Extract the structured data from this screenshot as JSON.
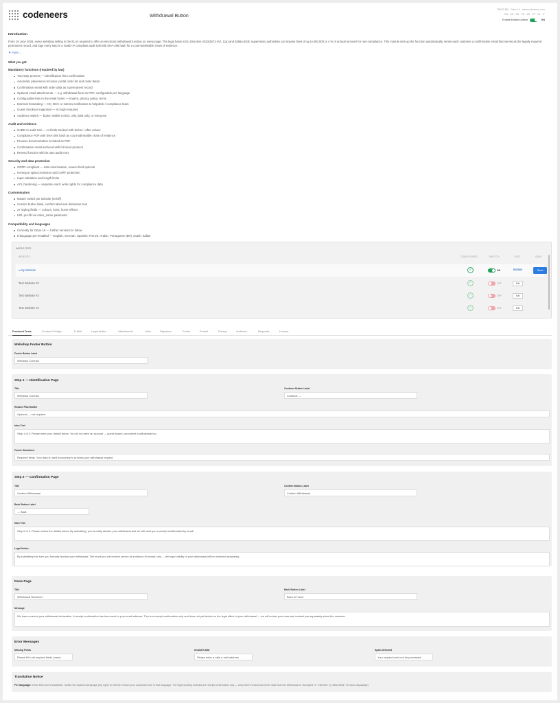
{
  "header": {
    "brand": "codeneers",
    "title": "Withdrawal Button",
    "meta_line1": "TR4E2.BB · Odoo 19 · www.codeneers.com",
    "meta_line2": "EN · DE · ES · FR · AR · PT · NL · IT",
    "global_toggle_label": "Enable/Disable Addon",
    "global_toggle_state": "ON"
  },
  "intro": {
    "heading": "Introduction",
    "paragraph": "From 19 June 2026, every webshop selling in the EU is required to offer an electronic withdrawal function on every page. The legal basis is EU Directive 2023/2673 (Art. 11a) and §356a BGB; supervisory authorities can impose fines of up to €50,000 or 4 % of annual turnover for non-compliance. This module sets up the function automatically, sends each customer a confirmation email that serves as the legally required permanent record, and logs every step in a GoBD-/A compliant audit trail with SHA-256 hash for a court-admissible chain of evidence.",
    "more": "▼ more ...",
    "what_you_get": "What you get:"
  },
  "features": [
    {
      "heading": "Mandatory functions (required by law)",
      "items": [
        "Two-step process — identification then confirmation",
        "Automatic placement on footer, portal order list and order detail",
        "Confirmation email with order data as a permanent record",
        "Optional email attachments — e.g. withdrawal form as PDF, configurable per language",
        "Configurable links in the email footer — imprint, privacy policy, terms",
        "External forwarding — CC, BCC or internal notification to helpdesk / compliance team",
        "Guest checkout supported — no login required",
        "Audience switch — button visible to B2C only, B2B only, or everyone"
      ]
    },
    {
      "heading": "Audit and evidence",
      "items": [
        "GoBD-/A audit trail — 14 fields tracked with before / after values",
        "Compliance PDF with SHA-256 hash as court-admissible chain of evidence",
        "Process documentation included as PDF",
        "Confirmation email archived with full send protocol",
        "Resend function with its own audit entry"
      ]
    },
    {
      "heading": "Security and data protection",
      "items": [
        "GDPR-compliant — data minimisation, reason field optional",
        "Honeypot spam protection and CSRF protection",
        "Input validation and length limits",
        "ACL hardening — separate read / write rights for compliance data"
      ]
    },
    {
      "heading": "Customisation",
      "items": [
        "Master switch per website (on/off)",
        "Custom button label, confirm label and disclaimer text",
        "27 styling fields — colours, fonts, hover effects",
        "URL pre-fill via order_name parameter"
      ]
    },
    {
      "heading": "Compatibility and languages",
      "items": [
        "Currently for Odoo 19 — further versions to follow",
        "8 language pre-installed — English, German, Spanish, French, Arabic, Portuguese (BR), Dutch, Italian"
      ]
    }
  ],
  "websites": {
    "heading": "WEBSITES",
    "columns": {
      "website": "WEBSITE",
      "configured": "CONFIGURED",
      "switch": "SWITCH",
      "edit": "EDIT",
      "save": "SAVE"
    },
    "rows": [
      {
        "name": "▾ My Website",
        "state": "ON",
        "edit": "EDITING",
        "save": "Save"
      },
      {
        "name": "Test Website #2",
        "state": "OFF",
        "edit": "Edit"
      },
      {
        "name": "Test Website #3",
        "state": "OFF",
        "edit": "Edit"
      },
      {
        "name": "Test Website #4",
        "state": "OFF",
        "edit": "Edit"
      }
    ]
  },
  "tabs": [
    "Frontend Texts",
    "Frontend Design",
    "E-Mail",
    "Legal Notice",
    "Attachments",
    "Links",
    "Signature",
    "Footer",
    "Embed",
    "Privacy",
    "Audience",
    "Requests",
    "License"
  ],
  "footer_button": {
    "heading": "Webshop Footer Button",
    "label_label": "Footer Button Label",
    "label_value": "Withdraw Contract"
  },
  "step1": {
    "heading": "Step 1 — Identification Page",
    "title_label": "Title",
    "title_value": "Withdraw Contract",
    "continue_label": "Continue Button Label",
    "continue_value": "Continue →",
    "reason_label": "Reason Placeholder",
    "reason_value": "Optional — not required",
    "intro_label": "Intro Text",
    "intro_value": "Step 1 of 2: Please enter your details below. You do not need an account — guest buyers can submit a withdrawal too.",
    "disclaimer_label": "Footer Disclaimer",
    "disclaimer_value": "Required fields. Your data is used exclusively to process your withdrawal request."
  },
  "step2": {
    "heading": "Step 2 — Confirmation Page",
    "title_label": "Title",
    "title_value": "Confirm Withdrawal",
    "confirm_label": "Confirm Button Label",
    "confirm_value": "Confirm Withdrawal",
    "back_label": "Back Button Label",
    "back_value": "← Back",
    "intro_label": "Intro Text",
    "intro_value": "Step 2 of 2: Please review the details below. By submitting, you formally declare your withdrawal and we will send you a receipt confirmation by email.",
    "legal_label": "Legal Notice",
    "legal_value": "By submitting this form you formally declare your withdrawal. The email you will receive serves as evidence of receipt only — the legal validity of your withdrawal will be reviewed separately."
  },
  "done": {
    "heading": "Done Page",
    "title_label": "Title",
    "title_value": "Withdrawal Received",
    "back_label": "Back Button Label",
    "back_value": "Back to Home",
    "message_label": "Message",
    "message_value": "We have received your withdrawal declaration. A receipt confirmation has been sent to your email address. This is a receipt confirmation only and does not yet decide on the legal effect of your withdrawal — we will review your case and contact you separately about the outcome."
  },
  "errors": {
    "heading": "Error Messages",
    "missing_label": "Missing Fields",
    "missing_value": "Please fill in all required fields (name,",
    "email_label": "Invalid E-Mail",
    "email_value": "Please enter a valid e-mail address.",
    "spam_label": "Spam Detected",
    "spam_value": "Your request could not be processed."
  },
  "translation": {
    "heading": "Translation Notice",
    "prefix": "Per language:",
    "text": "these fields are translatable. Switch the backend language (top right) to edit the version your customers see in that language. The legal wording defaults are receipt confirmation only — keep them neutral and never state that the withdrawal is \"accepted\" or \"effective\" (§ 356a BGB / em.ikon-anguiaday)."
  },
  "colors": {
    "accent": "#2b7de1",
    "on": "#21a05a",
    "off": "#f0a4ad"
  }
}
